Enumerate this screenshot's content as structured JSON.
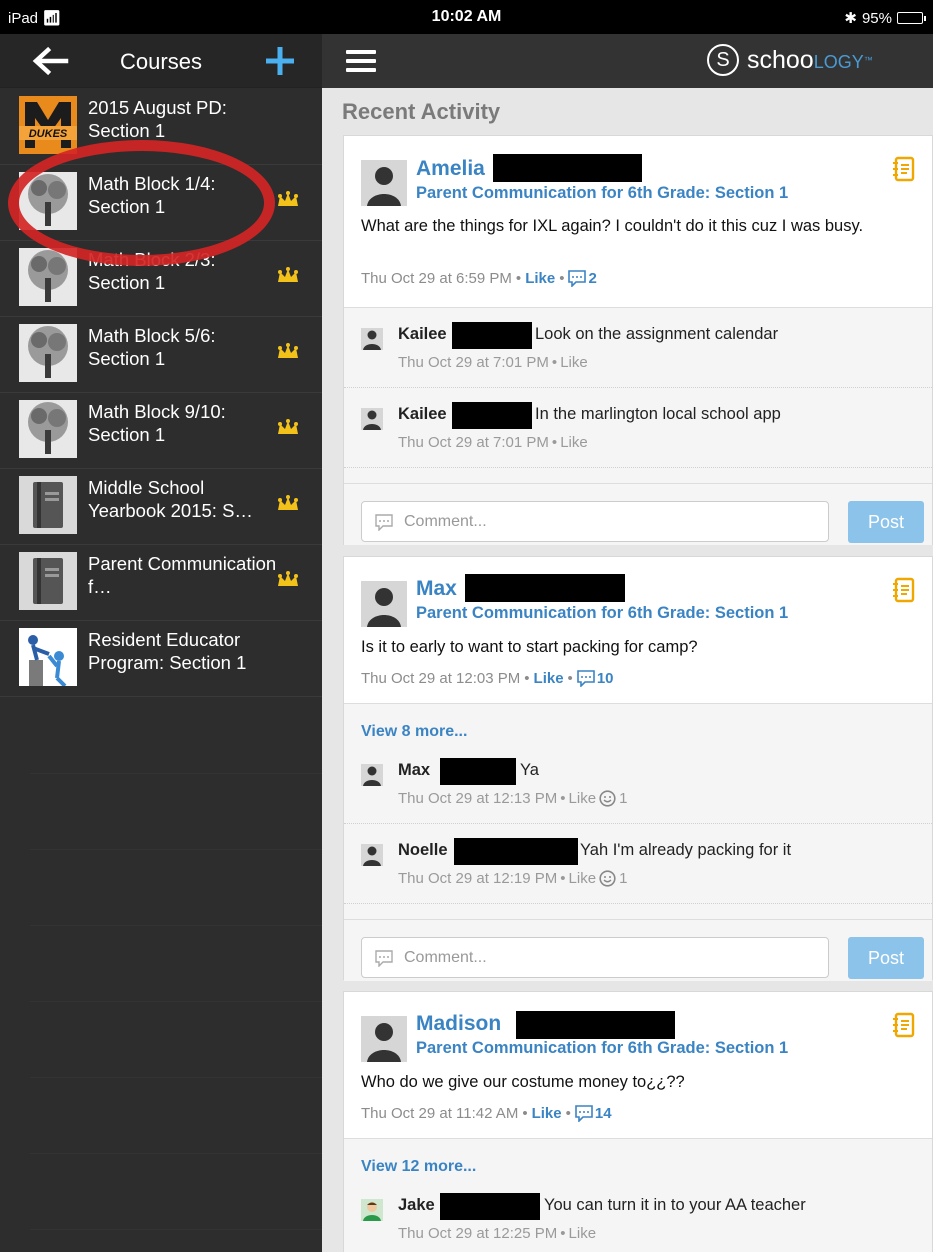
{
  "status_bar": {
    "device": "iPad",
    "time": "10:02 AM",
    "battery": "95%"
  },
  "sidebar": {
    "title": "Courses",
    "courses": [
      {
        "name": "2015 August PD: Section 1",
        "admin": false,
        "thumb": "dukes-logo"
      },
      {
        "name": "Math Block 1/4: Section 1",
        "admin": true,
        "thumb": "tree"
      },
      {
        "name": "Math Block 2/3: Section 1",
        "admin": true,
        "thumb": "tree"
      },
      {
        "name": "Math Block 5/6: Section 1",
        "admin": true,
        "thumb": "tree"
      },
      {
        "name": "Math Block 9/10: Section 1",
        "admin": true,
        "thumb": "tree"
      },
      {
        "name": "Middle School Yearbook 2015: S…",
        "admin": true,
        "thumb": "book"
      },
      {
        "name": "Parent Communication f…",
        "admin": true,
        "thumb": "book"
      },
      {
        "name": "Resident Educator Program: Section 1",
        "admin": false,
        "thumb": "climbers"
      }
    ],
    "dukes_logo_text": "DUKES"
  },
  "main": {
    "logo": {
      "text_a": "schoo",
      "text_b": "logy",
      "trademark": "™"
    },
    "section_title": "Recent Activity",
    "comment_placeholder": "Comment...",
    "post_label": "Post",
    "posts": [
      {
        "author": "Amelia",
        "group": "Parent Communication for 6th Grade: Section 1",
        "body": "What are the things for IXL again? I couldn't do it this cuz I was busy.",
        "time": "Thu Oct 29 at 6:59 PM",
        "like": "Like",
        "comment_count": "2",
        "view_more": "",
        "replies": [
          {
            "name": "Kailee",
            "text": "Look on the assignment calendar",
            "time": "Thu Oct 29 at 7:01 PM",
            "like": "Like",
            "likes": ""
          },
          {
            "name": "Kailee",
            "text": "In the marlington local school app",
            "time": "Thu Oct 29 at 7:01 PM",
            "like": "Like",
            "likes": ""
          }
        ]
      },
      {
        "author": "Max",
        "group": "Parent Communication for 6th Grade: Section 1",
        "body": "Is it to early to want to start packing for camp?",
        "time": "Thu Oct 29 at 12:03 PM",
        "like": "Like",
        "comment_count": "10",
        "view_more": "View 8 more...",
        "replies": [
          {
            "name": "Max",
            "text": "Ya",
            "time": "Thu Oct 29 at 12:13 PM",
            "like": "Like",
            "likes": "1"
          },
          {
            "name": "Noelle",
            "text": "Yah I'm already packing for it",
            "time": "Thu Oct 29 at 12:19 PM",
            "like": "Like",
            "likes": "1"
          }
        ]
      },
      {
        "author": "Madison",
        "group": "Parent Communication for 6th Grade: Section 1",
        "body": "Who do we give our costume money to¿¿??",
        "time": "Thu Oct 29 at 11:42 AM",
        "like": "Like",
        "comment_count": "14",
        "view_more": "View 12 more...",
        "replies": [
          {
            "name": "Jake",
            "text": "You can turn it in to your AA teacher",
            "time": "Thu Oct 29 at 12:25 PM",
            "like": "Like",
            "likes": ""
          }
        ]
      }
    ]
  },
  "colors": {
    "link_blue": "#3b84c4",
    "post_button": "#8cc3ea",
    "crown": "#f2c21b",
    "annotation_red": "#d42525"
  }
}
